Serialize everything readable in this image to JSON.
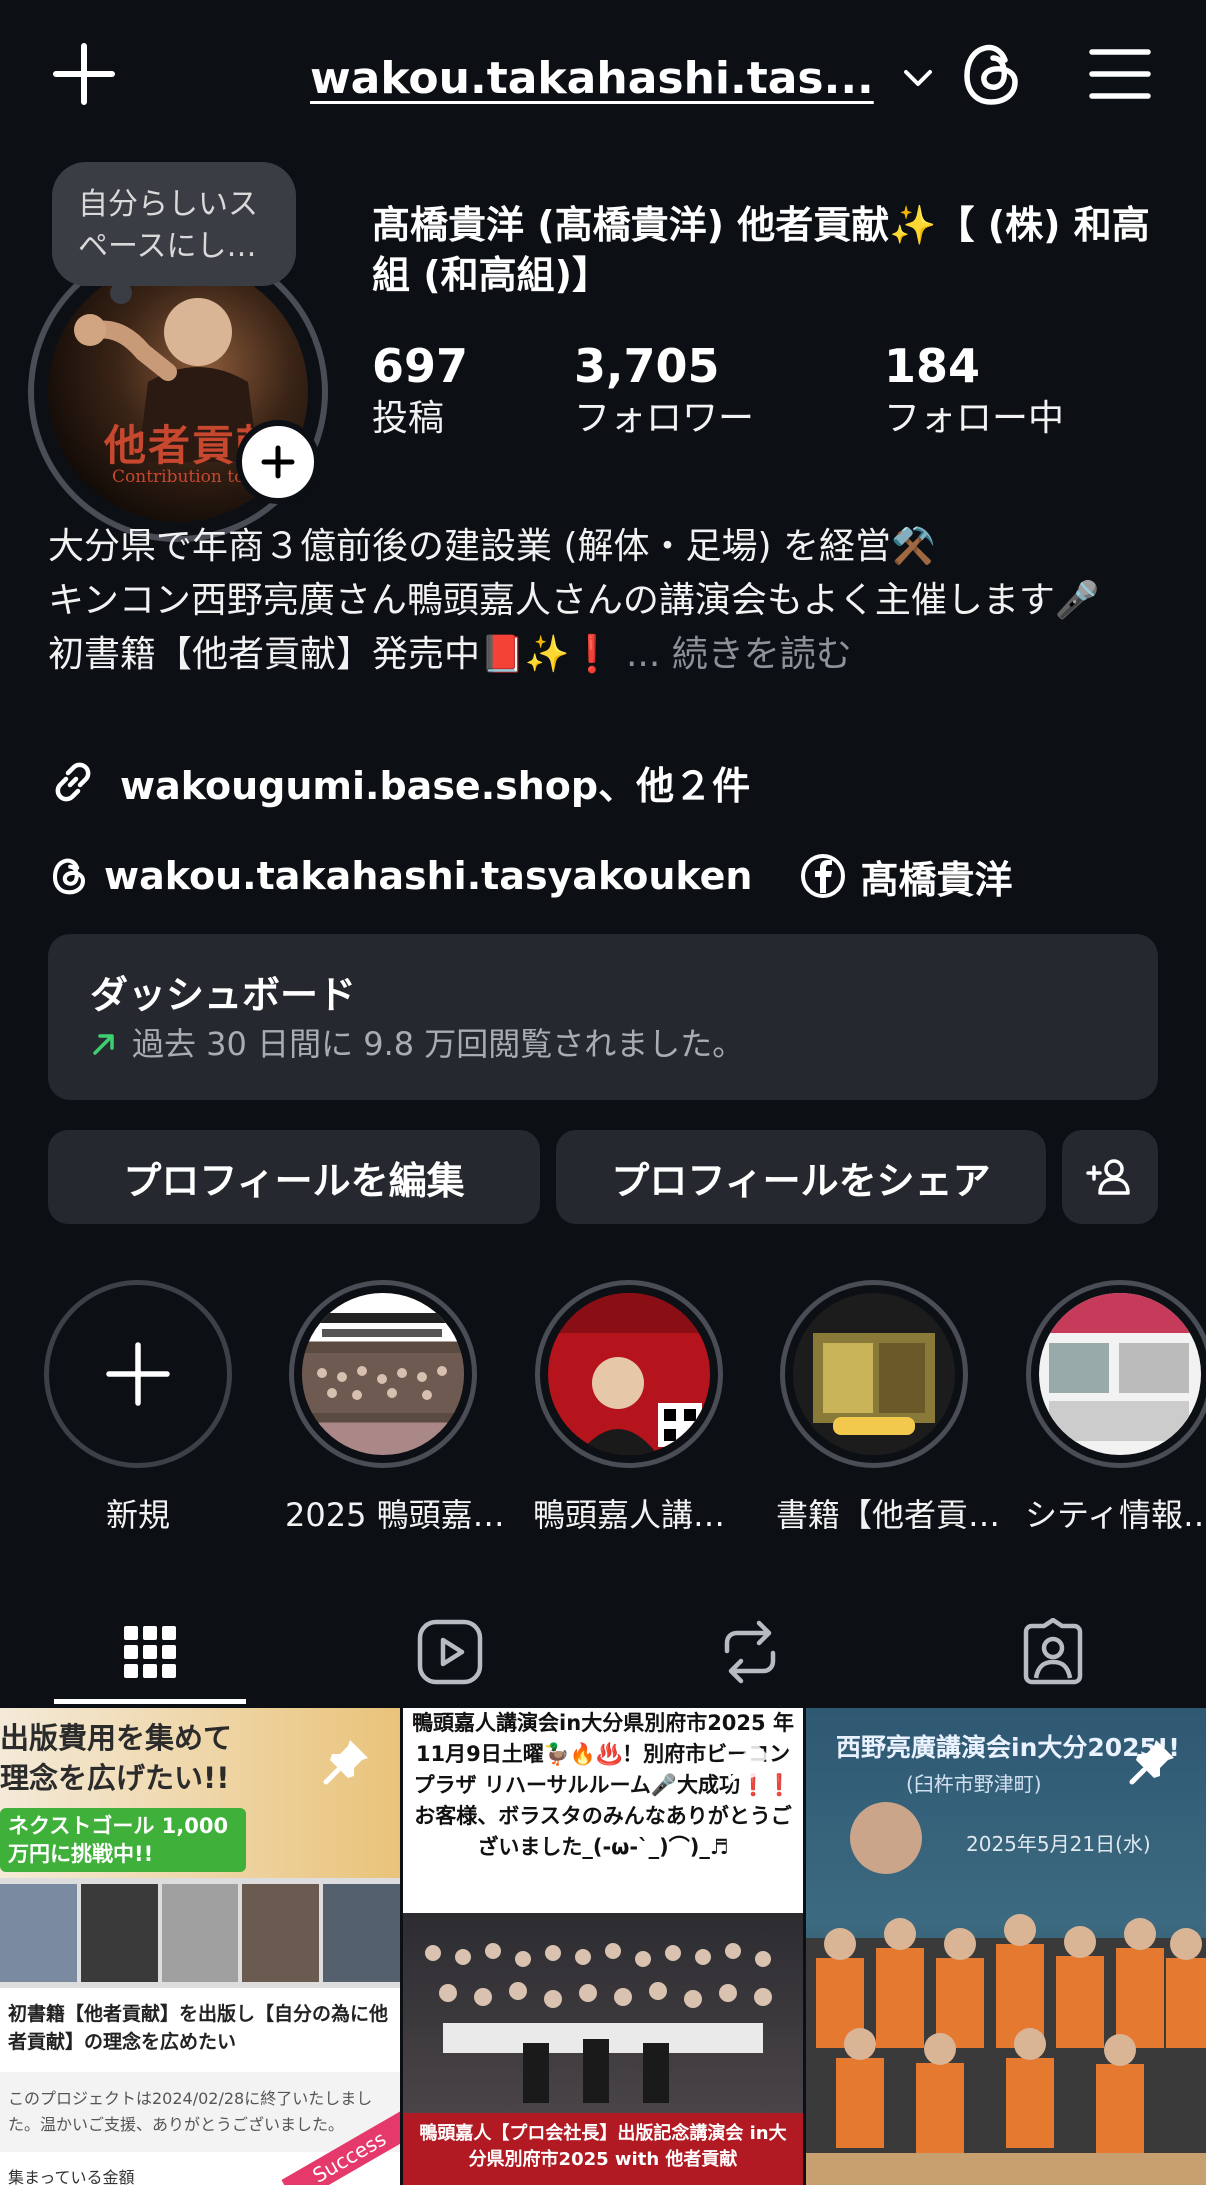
{
  "header": {
    "username": "wakou.takahashi.tas...",
    "icons": [
      "plus-icon",
      "chevron-down-icon",
      "threads-icon",
      "hamburger-menu-icon"
    ]
  },
  "profile": {
    "note": "自分らしいスペースにし…",
    "avatar_text": "他者貢献",
    "avatar_subtext": "Contribution to Oth",
    "display_name": "髙橋貴洋 (髙橋貴洋) 他者貢献✨【 (株) 和高組 (和高組)】",
    "stats": [
      {
        "value": "697",
        "label": "投稿"
      },
      {
        "value": "3,705",
        "label": "フォロワー"
      },
      {
        "value": "184",
        "label": "フォロー中"
      }
    ],
    "bio_line1": "大分県で年商３億前後の建設業 (解体・足場) を経営⚒️",
    "bio_line2": "キンコン西野亮廣さん鴨頭嘉人さんの講演会もよく主催します🎤",
    "bio_line3": "初書籍【他者貢献】発売中📕✨❗",
    "bio_more": "... 続きを読む",
    "link": "wakougumi.base.shop、他２件",
    "threads_handle": "wakou.takahashi.tasyakouken",
    "facebook_name": "髙橋貴洋"
  },
  "dashboard": {
    "title": "ダッシュボード",
    "subtitle": "過去 30 日間に 9.8 万回閲覧されました。"
  },
  "actions": {
    "edit_profile": "プロフィールを編集",
    "share_profile": "プロフィールをシェア"
  },
  "highlights": [
    {
      "label": "新規"
    },
    {
      "label": "2025 鴨頭嘉…"
    },
    {
      "label": "鴨頭嘉人講…"
    },
    {
      "label": "書籍【他者貢…"
    },
    {
      "label": "シティ情報…"
    }
  ],
  "tabs": [
    "grid-icon",
    "reels-icon",
    "reposts-icon",
    "tagged-icon"
  ],
  "posts": [
    {
      "headline": "出版費用を集めて理念を広げたい!!",
      "goal": "ネクストゴール 1,000万円に挑戦中!!",
      "caption": "初書籍【他者貢献】を出版し【自分の為に他者貢献】の理念を広めたい",
      "note": "このプロジェクトは2024/02/28に終了いたしました。温かいご支援、ありがとうございました。",
      "footer": "集まっている金額",
      "badge": "Success"
    },
    {
      "headline": "鴨頭嘉人講演会in大分県別府市2025 年11月9日土曜🦆🔥♨️！別府市ビーコンプラザ リハーサルルーム🎤大成功❗❗ お客様、ボラスタのみんなありがとうございました_(-ω-`_)⌒)_♬",
      "footer": "鴨頭嘉人【プロ会社長】出版記念講演会 in大分県別府市2025 with 他者貢献"
    },
    {
      "headline": "西野亮廣講演会in大分2025!!",
      "sub": "(臼杵市野津町)",
      "date": "2025年5月21日(水)"
    }
  ]
}
